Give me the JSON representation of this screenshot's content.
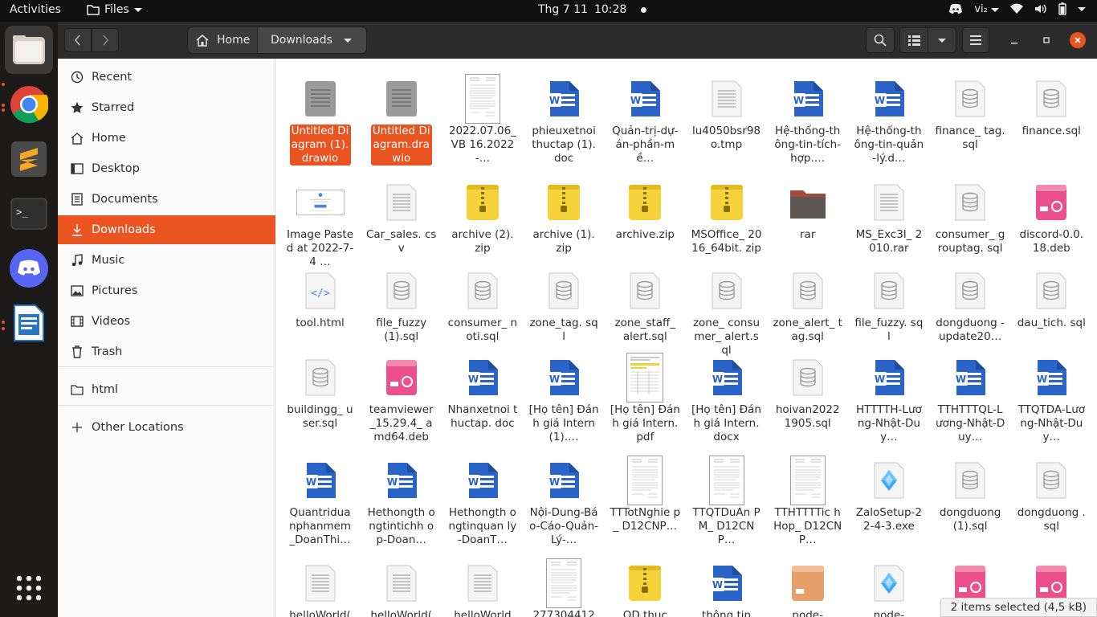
{
  "topbar": {
    "activities": "Activities",
    "app_name": "Files",
    "date": "Thg 7 11",
    "time": "10:28",
    "input_method": "vi₂"
  },
  "header": {
    "path_home": "Home",
    "path_current": "Downloads"
  },
  "sidebar": {
    "items": [
      {
        "label": "Recent",
        "icon": "clock-icon"
      },
      {
        "label": "Starred",
        "icon": "star-icon"
      },
      {
        "label": "Home",
        "icon": "home-icon"
      },
      {
        "label": "Desktop",
        "icon": "desktop-icon"
      },
      {
        "label": "Documents",
        "icon": "document-icon"
      },
      {
        "label": "Downloads",
        "icon": "download-icon"
      },
      {
        "label": "Music",
        "icon": "music-icon"
      },
      {
        "label": "Pictures",
        "icon": "picture-icon"
      },
      {
        "label": "Videos",
        "icon": "video-icon"
      },
      {
        "label": "Trash",
        "icon": "trash-icon"
      }
    ],
    "bookmark": "html",
    "other_locations": "Other Locations"
  },
  "files": [
    {
      "name": "Untitled Diagram (1).drawio",
      "type": "drawio",
      "selected": true
    },
    {
      "name": "Untitled Diagram.drawio",
      "type": "drawio",
      "selected": true
    },
    {
      "name": "2022.07.06_VB 16.2022-…",
      "type": "thumb"
    },
    {
      "name": "phieuxetnoi thuctap (1).doc",
      "type": "word"
    },
    {
      "name": "Quản-trị-dự-án-phần-mề…",
      "type": "word"
    },
    {
      "name": "lu4050bsr98o.tmp",
      "type": "text"
    },
    {
      "name": "Hệ-thống-thông-tin-tích-hợp.…",
      "type": "word"
    },
    {
      "name": "Hệ-thống-thông-tin-quản-lý.d…",
      "type": "word"
    },
    {
      "name": "finance_ tag.sql",
      "type": "sql"
    },
    {
      "name": "finance.sql",
      "type": "sql"
    },
    {
      "name": "Image Pasted at 2022-7-4 …",
      "type": "image"
    },
    {
      "name": "Car_sales. csv",
      "type": "text"
    },
    {
      "name": "archive (2). zip",
      "type": "zip"
    },
    {
      "name": "archive (1). zip",
      "type": "zip"
    },
    {
      "name": "archive.zip",
      "type": "zip"
    },
    {
      "name": "MSOffice_ 2016_64bit. zip",
      "type": "zip"
    },
    {
      "name": "rar",
      "type": "folder"
    },
    {
      "name": "MS_Exc3l_ 2010.rar",
      "type": "text"
    },
    {
      "name": "consumer_ grouptag. sql",
      "type": "sql"
    },
    {
      "name": "discord-0.0.18.deb",
      "type": "deb"
    },
    {
      "name": "tool.html",
      "type": "html"
    },
    {
      "name": "file_fuzzy (1).sql",
      "type": "sql"
    },
    {
      "name": "consumer_ noti.sql",
      "type": "sql"
    },
    {
      "name": "zone_tag. sql",
      "type": "sql"
    },
    {
      "name": "zone_staff_ alert.sql",
      "type": "sql"
    },
    {
      "name": "zone_ consumer_ alert.sql",
      "type": "sql"
    },
    {
      "name": "zone_alert_ tag.sql",
      "type": "sql"
    },
    {
      "name": "file_fuzzy. sql",
      "type": "sql"
    },
    {
      "name": "dongduong - update20…",
      "type": "sql"
    },
    {
      "name": "dau_tich. sql",
      "type": "sql"
    },
    {
      "name": "buildingg_ user.sql",
      "type": "sql"
    },
    {
      "name": "teamviewer _15.29.4_ amd64.deb",
      "type": "deb"
    },
    {
      "name": "Nhanxetnoi thuctap. doc",
      "type": "word"
    },
    {
      "name": "[Họ tên] Đánh giá Intern(1).…",
      "type": "word"
    },
    {
      "name": "[Họ tên] Đánh giá Intern.pdf",
      "type": "pdfthumb"
    },
    {
      "name": "[Họ tên] Đánh giá Intern.docx",
      "type": "word"
    },
    {
      "name": "hoivan2022 1905.sql",
      "type": "sql"
    },
    {
      "name": "HTTTTH-Lương-Nhật-Duy…",
      "type": "word"
    },
    {
      "name": "TTHTTTQL-Lương-Nhật-Duy…",
      "type": "word"
    },
    {
      "name": "TTQTDA-Lương-Nhật-Duy…",
      "type": "word"
    },
    {
      "name": "Quantridua nphanmem _DoanThi…",
      "type": "word"
    },
    {
      "name": "Hethongth ongtintichh op-Doan…",
      "type": "word"
    },
    {
      "name": "Hethongth ongtinquan ly-DoanT…",
      "type": "word"
    },
    {
      "name": "Nội-Dung-Báo-Cáo-Quản-Lý-…",
      "type": "word"
    },
    {
      "name": "TTTotNghie p_ D12CNP…",
      "type": "thumb"
    },
    {
      "name": "TTQTDuAn PM_ D12CNP…",
      "type": "thumb"
    },
    {
      "name": "TTHTTTTic hHop_ D12CNP…",
      "type": "thumb"
    },
    {
      "name": "ZaloSetup-22-4-3.exe",
      "type": "exe"
    },
    {
      "name": "dongduong (1).sql",
      "type": "sql"
    },
    {
      "name": "dongduong .sql",
      "type": "sql"
    },
    {
      "name": "helloWorld(",
      "type": "text"
    },
    {
      "name": "helloWorld(",
      "type": "text"
    },
    {
      "name": "helloWorld",
      "type": "text"
    },
    {
      "name": "277304412",
      "type": "thumb"
    },
    {
      "name": "QD thuc",
      "type": "zip"
    },
    {
      "name": "thông tin",
      "type": "word"
    },
    {
      "name": "node-",
      "type": "pkg"
    },
    {
      "name": "node-",
      "type": "exe"
    },
    {
      "name": "",
      "type": "deb"
    },
    {
      "name": "",
      "type": "deb"
    }
  ],
  "status": "2 items selected  (4,5 kB)"
}
